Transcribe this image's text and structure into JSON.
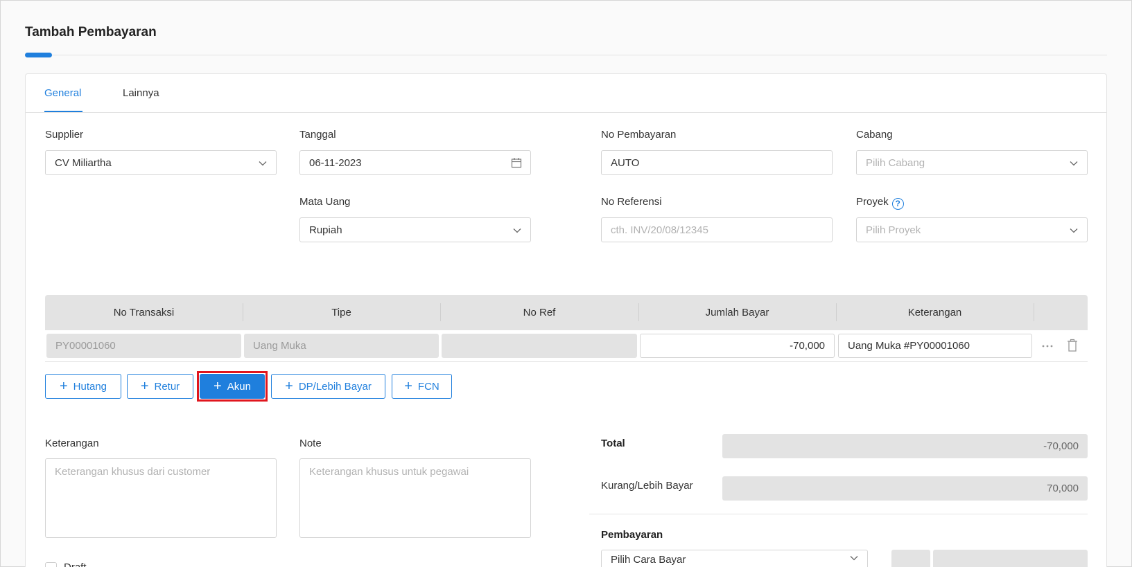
{
  "page": {
    "title": "Tambah Pembayaran"
  },
  "tabs": [
    {
      "label": "General",
      "active": true
    },
    {
      "label": "Lainnya",
      "active": false
    }
  ],
  "form": {
    "supplier": {
      "label": "Supplier",
      "value": "CV Miliartha"
    },
    "tanggal": {
      "label": "Tanggal",
      "value": "06-11-2023"
    },
    "no_pembayaran": {
      "label": "No Pembayaran",
      "value": "AUTO"
    },
    "cabang": {
      "label": "Cabang",
      "placeholder": "Pilih Cabang"
    },
    "mata_uang": {
      "label": "Mata Uang",
      "value": "Rupiah"
    },
    "no_referensi": {
      "label": "No Referensi",
      "placeholder": "cth. INV/20/08/12345"
    },
    "proyek": {
      "label": "Proyek",
      "placeholder": "Pilih Proyek",
      "help": "?"
    }
  },
  "table": {
    "columns": [
      "No Transaksi",
      "Tipe",
      "No Ref",
      "Jumlah Bayar",
      "Keterangan"
    ],
    "rows": [
      {
        "no_transaksi": "PY00001060",
        "tipe": "Uang Muka",
        "no_ref": "",
        "jumlah_bayar": "-70,000",
        "keterangan": "Uang Muka #PY00001060"
      }
    ]
  },
  "add_buttons": {
    "hutang": "Hutang",
    "retur": "Retur",
    "akun": "Akun",
    "dp": "DP/Lebih Bayar",
    "fcn": "FCN"
  },
  "notes": {
    "keterangan": {
      "label": "Keterangan",
      "placeholder": "Keterangan khusus dari customer"
    },
    "note": {
      "label": "Note",
      "placeholder": "Keterangan khusus untuk pegawai"
    }
  },
  "summary": {
    "total": {
      "label": "Total",
      "value": "-70,000"
    },
    "kurang_lebih": {
      "label": "Kurang/Lebih Bayar",
      "value": "70,000"
    },
    "pembayaran": {
      "label": "Pembayaran",
      "placeholder": "Pilih Cara Bayar"
    }
  },
  "draft": {
    "label": "Draft"
  },
  "colors": {
    "accent": "#1f7fdd",
    "highlight": "#e0161e"
  }
}
